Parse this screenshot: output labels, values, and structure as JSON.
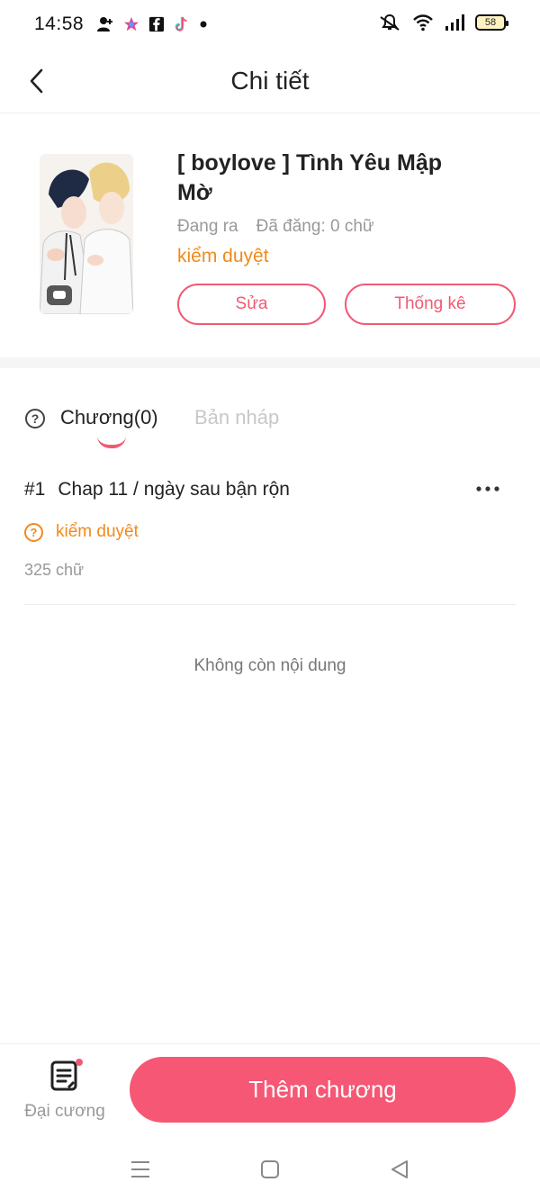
{
  "status_bar": {
    "time": "14:58",
    "battery": "58"
  },
  "header": {
    "title": "Chi tiết"
  },
  "book": {
    "title": "[ boylove ] Tình Yêu Mập Mờ",
    "state": "Đang ra",
    "published": "Đã đăng: 0 chữ",
    "review_status": "kiểm duyệt",
    "edit_label": "Sửa",
    "stats_label": "Thống kê"
  },
  "tabs": {
    "chapters_label": "Chương(0)",
    "drafts_label": "Bản nháp"
  },
  "chapters": [
    {
      "number": "#1",
      "title": "Chap 11 / ngày sau bận rộn",
      "status": "kiểm duyệt",
      "words": "325 chữ"
    }
  ],
  "empty_text": "Không còn nội dung",
  "bottom_bar": {
    "outline_label": "Đại cương",
    "add_chapter_label": "Thêm chương"
  },
  "colors": {
    "accent": "#f05a75",
    "button_fill": "#f55774",
    "review": "#f08a1c"
  }
}
